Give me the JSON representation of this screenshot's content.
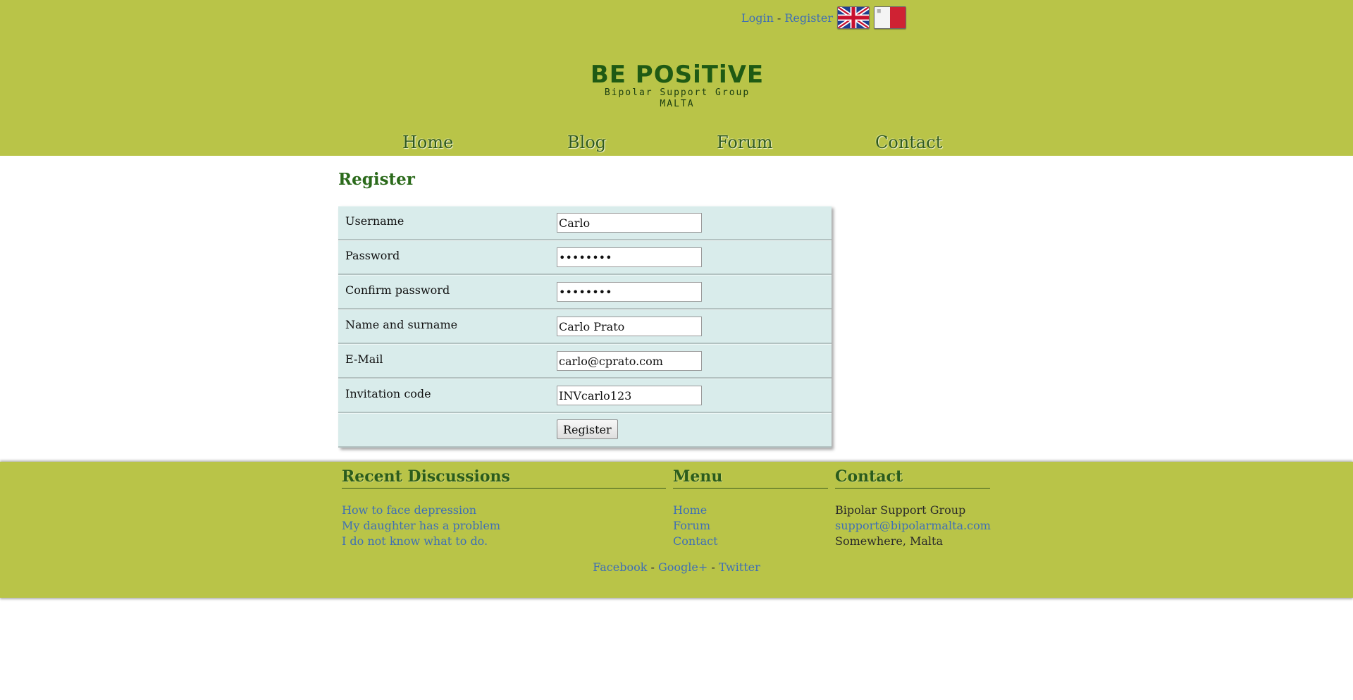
{
  "topbar": {
    "login": "Login",
    "separator": "-",
    "register": "Register",
    "flags": [
      "uk-flag-icon",
      "malta-flag-icon"
    ]
  },
  "logo": {
    "title": "BE POSiTiVE",
    "subtitle": "Bipolar Support Group MALTA"
  },
  "nav": {
    "items": [
      "Home",
      "Blog",
      "Forum",
      "Contact"
    ]
  },
  "main": {
    "title": "Register",
    "fields": [
      {
        "label": "Username",
        "value": "Carlo",
        "type": "text"
      },
      {
        "label": "Password",
        "value": "••••••••",
        "type": "password"
      },
      {
        "label": "Confirm password",
        "value": "••••••••",
        "type": "password"
      },
      {
        "label": "Name and surname",
        "value": "Carlo Prato",
        "type": "text"
      },
      {
        "label": "E-Mail",
        "value": "carlo@cprato.com",
        "type": "text"
      },
      {
        "label": "Invitation code",
        "value": "INVcarlo123",
        "type": "text"
      }
    ],
    "submit_label": "Register"
  },
  "footer": {
    "recent": {
      "title": "Recent Discussions",
      "items": [
        "How to face depression",
        "My daughter has a problem",
        "I do not know what to do."
      ]
    },
    "menu": {
      "title": "Menu",
      "items": [
        "Home",
        "Forum",
        "Contact"
      ]
    },
    "contact": {
      "title": "Contact",
      "name": "Bipolar Support Group",
      "email": "support@bipolarmalta.com",
      "location": "Somewhere, Malta"
    },
    "social": [
      "Facebook",
      "Google+",
      "Twitter"
    ],
    "social_separator": "-"
  },
  "colors": {
    "header_bg": "#b9c448",
    "link": "#3f6fb5",
    "title_green": "#2b6a1b",
    "form_row_bg": "#d9eceb"
  }
}
